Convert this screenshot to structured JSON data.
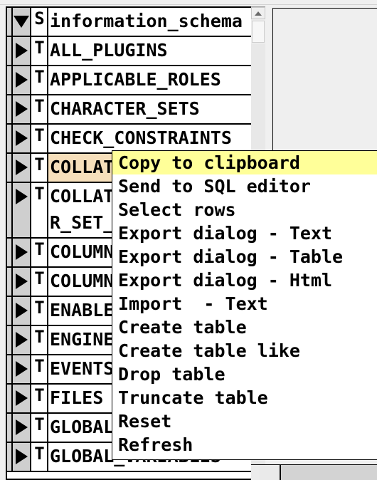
{
  "tree": {
    "name": "database-object-tree",
    "icons": {
      "expanded": "triangle-down-icon",
      "collapsed": "triangle-right-icon",
      "schema": "S",
      "table": "T"
    },
    "rows": [
      {
        "type_glyph": "S",
        "label": "information_schema",
        "expanded": true,
        "selected": false,
        "tall": false
      },
      {
        "type_glyph": "T",
        "label": "ALL_PLUGINS",
        "expanded": false,
        "selected": false,
        "tall": false
      },
      {
        "type_glyph": "T",
        "label": "APPLICABLE_ROLES",
        "expanded": false,
        "selected": false,
        "tall": false
      },
      {
        "type_glyph": "T",
        "label": "CHARACTER_SETS",
        "expanded": false,
        "selected": false,
        "tall": false
      },
      {
        "type_glyph": "T",
        "label": "CHECK_CONSTRAINTS",
        "expanded": false,
        "selected": false,
        "tall": false
      },
      {
        "type_glyph": "T",
        "label": "COLLATIONS",
        "expanded": false,
        "selected": true,
        "tall": false
      },
      {
        "type_glyph": "T",
        "label": "COLLATION_CHARACTER_SET_APPLICABILITY",
        "expanded": false,
        "selected": false,
        "tall": true
      },
      {
        "type_glyph": "T",
        "label": "COLUMNS",
        "expanded": false,
        "selected": false,
        "tall": false
      },
      {
        "type_glyph": "T",
        "label": "COLUMN_PRIVILEGES",
        "expanded": false,
        "selected": false,
        "tall": false
      },
      {
        "type_glyph": "T",
        "label": "ENABLED_ROLES",
        "expanded": false,
        "selected": false,
        "tall": false
      },
      {
        "type_glyph": "T",
        "label": "ENGINES",
        "expanded": false,
        "selected": false,
        "tall": false
      },
      {
        "type_glyph": "T",
        "label": "EVENTS",
        "expanded": false,
        "selected": false,
        "tall": false
      },
      {
        "type_glyph": "T",
        "label": "FILES",
        "expanded": false,
        "selected": false,
        "tall": false
      },
      {
        "type_glyph": "T",
        "label": "GLOBAL_STATUS",
        "expanded": false,
        "selected": false,
        "tall": false
      },
      {
        "type_glyph": "T",
        "label": "GLOBAL_VARIABLES",
        "expanded": false,
        "selected": false,
        "tall": false
      }
    ]
  },
  "context_menu": {
    "name": "table-context-menu",
    "highlighted_index": 0,
    "items": [
      {
        "label": "Copy to clipboard"
      },
      {
        "label": "Send to SQL editor"
      },
      {
        "label": "Select rows"
      },
      {
        "label": "Export dialog - Text"
      },
      {
        "label": "Export dialog - Table"
      },
      {
        "label": "Export dialog - Html"
      },
      {
        "label": "Import  - Text"
      },
      {
        "label": "Create table"
      },
      {
        "label": "Create table like"
      },
      {
        "label": "Drop table"
      },
      {
        "label": "Truncate table"
      },
      {
        "label": "Reset"
      },
      {
        "label": "Refresh"
      }
    ]
  },
  "scrollbars": {
    "vertical": {
      "name": "tree-vertical-scrollbar",
      "up_arrow": "triangle-up-icon"
    },
    "horizontal": {
      "name": "tree-horizontal-scrollbar"
    }
  },
  "colors": {
    "selection_row": "#f6dfbb",
    "menu_highlight": "#ffff99",
    "panel_background": "#efefef",
    "tree_background": "#ffffff"
  }
}
